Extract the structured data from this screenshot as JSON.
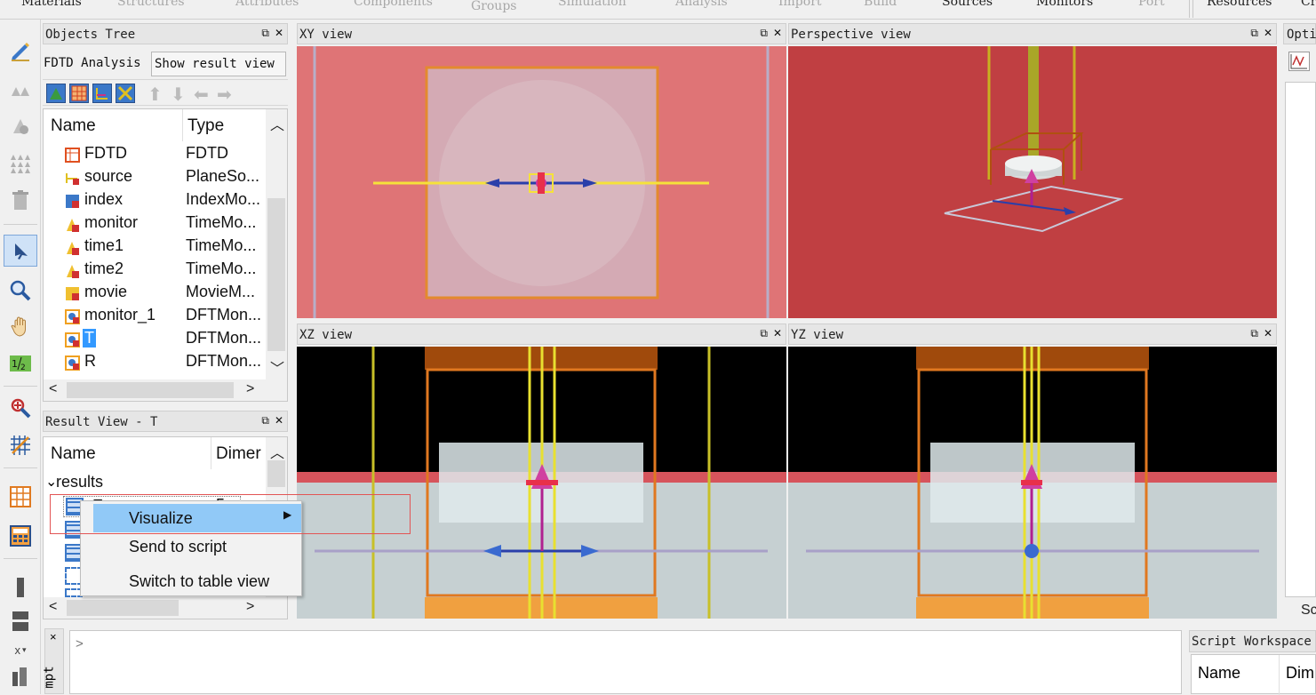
{
  "ribbon": {
    "tabs": [
      "Materials",
      "Structures",
      "Attributes",
      "Components",
      "Groups",
      "Simulation",
      "Analysis",
      "Import",
      "Build",
      "Sources",
      "Monitors",
      "Port",
      "Resources",
      "Cr"
    ]
  },
  "objects_tree": {
    "title": "Objects Tree",
    "analysis_label": "FDTD Analysis",
    "show_result_button": "Show result view",
    "col_name": "Name",
    "col_type": "Type",
    "items": [
      {
        "name": "FDTD",
        "type": "FDTD",
        "icon": "fdtd-icon"
      },
      {
        "name": "source",
        "type": "PlaneSo...",
        "icon": "source-icon"
      },
      {
        "name": "index",
        "type": "IndexMo...",
        "icon": "index-monitor-icon"
      },
      {
        "name": "monitor",
        "type": "TimeMo...",
        "icon": "time-monitor-icon"
      },
      {
        "name": "time1",
        "type": "TimeMo...",
        "icon": "time-monitor-icon"
      },
      {
        "name": "time2",
        "type": "TimeMo...",
        "icon": "time-monitor-icon"
      },
      {
        "name": "movie",
        "type": "MovieM...",
        "icon": "movie-monitor-icon"
      },
      {
        "name": "monitor_1",
        "type": "DFTMon...",
        "icon": "dft-monitor-icon"
      },
      {
        "name": "T",
        "type": "DFTMon...",
        "icon": "dft-monitor-icon"
      },
      {
        "name": "R",
        "type": "DFTMon...",
        "icon": "dft-monitor-icon"
      }
    ]
  },
  "result_view": {
    "title": "Result View - T",
    "col_name": "Name",
    "col_dim": "Dimer",
    "group": "results",
    "row1_name": "E",
    "row1_dim": "5"
  },
  "context_menu": {
    "items": [
      "Visualize",
      "Send to script",
      "Switch to table view"
    ]
  },
  "views": {
    "xy": "XY view",
    "perspective": "Perspective view",
    "xz": "XZ view",
    "yz": "YZ view"
  },
  "options_panel": {
    "title": "Opti"
  },
  "script_workspace": {
    "title": "Script Workspace",
    "col_name": "Name",
    "col_dim": "Dim"
  },
  "script_prompt": {
    "label": "mpt",
    "caret": ">",
    "close": "×"
  },
  "left_toolbar": {
    "items": [
      "edit-icon",
      "arrange-icon",
      "align-icon",
      "array-icon",
      "delete-icon",
      "select-icon",
      "zoom-icon",
      "pan-icon",
      "ruler-icon",
      "zoom-region-icon",
      "grid-icon",
      "layout-icon",
      "calculator-icon",
      "view-single-icon",
      "view-split-icon",
      "axis-icon",
      "bar-icon"
    ],
    "axis_label": "x"
  },
  "colors": {
    "xy_bg": "#df7476",
    "perspective_bg": "#c03f42",
    "selection": "#3399ff",
    "menu_highlight": "#91c9f7"
  }
}
